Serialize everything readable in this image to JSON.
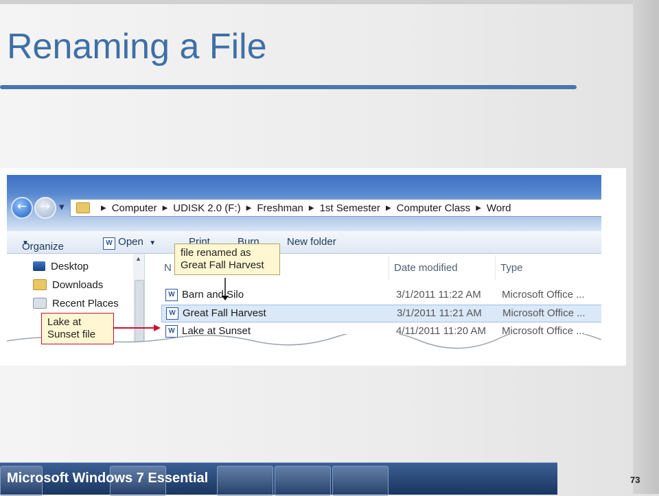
{
  "slide": {
    "title": "Renaming a File",
    "footer": "Microsoft Windows 7 Essential",
    "page_number": "73"
  },
  "explorer": {
    "breadcrumb": [
      "Computer",
      "UDISK 2.0 (F:)",
      "Freshman",
      "1st Semester",
      "Computer Class",
      "Word"
    ],
    "toolbar": {
      "organize": "Organize",
      "open": "Open",
      "print": "Print",
      "burn": "Burn",
      "new_folder": "New folder"
    },
    "nav": [
      "Desktop",
      "Downloads",
      "Recent Places"
    ],
    "columns": {
      "name": "N",
      "date": "Date modified",
      "type": "Type"
    },
    "files": [
      {
        "name": "Barn and Silo",
        "date": "3/1/2011 11:22 AM",
        "type": "Microsoft Office ...",
        "selected": false
      },
      {
        "name": "Great Fall Harvest",
        "date": "3/1/2011 11:21 AM",
        "type": "Microsoft Office ...",
        "selected": true
      },
      {
        "name": "Lake at Sunset",
        "date": "4/11/2011 11:20 AM",
        "type": "Microsoft Office ...",
        "selected": false
      }
    ]
  },
  "callouts": {
    "renamed": [
      "file renamed as",
      "Great Fall Harvest"
    ],
    "lake": [
      "Lake at",
      "Sunset file"
    ]
  },
  "colors": {
    "title": "#3e6fa7",
    "arrow_red": "#c8102e",
    "selection": "#dbe8f8",
    "taskbar": "#1a3560"
  }
}
